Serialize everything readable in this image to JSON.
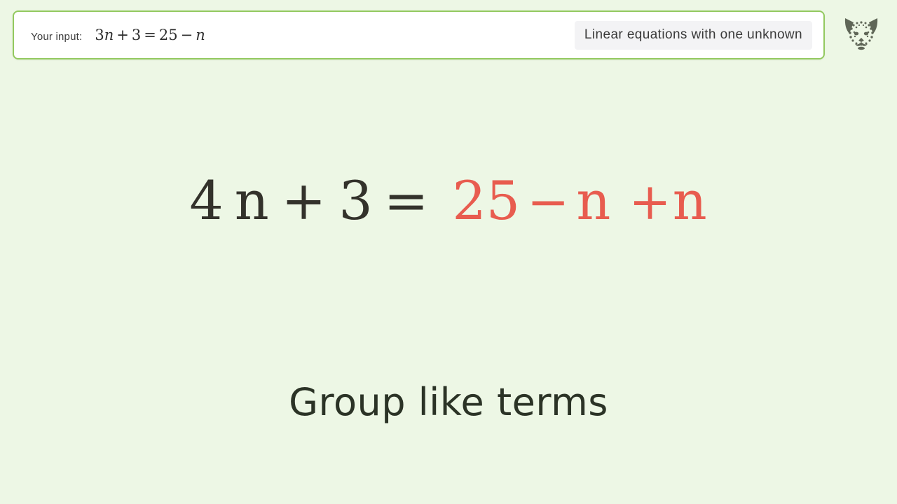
{
  "page": {
    "background_color": "#edf7e5"
  },
  "input_bar": {
    "label": "Your input:",
    "equation": {
      "coefficient": "3",
      "variable": "n",
      "plus": "+",
      "constant": "3",
      "equals": "=",
      "rhs_constant": "25",
      "minus": "−",
      "rhs_variable": "n",
      "full_text": "3n + 3 = 25 − n"
    },
    "border_color": "#93c95f",
    "fill_color": "#ffffff"
  },
  "lesson": {
    "title": "Linear equations with one unknown",
    "pill_color": "#f3f3f5"
  },
  "logo": {
    "name": "leopard-face-logo",
    "color": "#5f6657"
  },
  "equation": {
    "lhs": {
      "coefficient": "4",
      "variable": "n",
      "plus": "+",
      "constant": "3",
      "color": "#33322b"
    },
    "equals": "=",
    "rhs": {
      "constant": "25",
      "minus": "−",
      "variable": "n",
      "added_plus": "+",
      "added_variable": "n",
      "color": "#e85c4f"
    },
    "full_text": "4 n + 3 = 25 − n +n"
  },
  "caption": {
    "text": "Group like terms",
    "color": "#2b3326"
  }
}
